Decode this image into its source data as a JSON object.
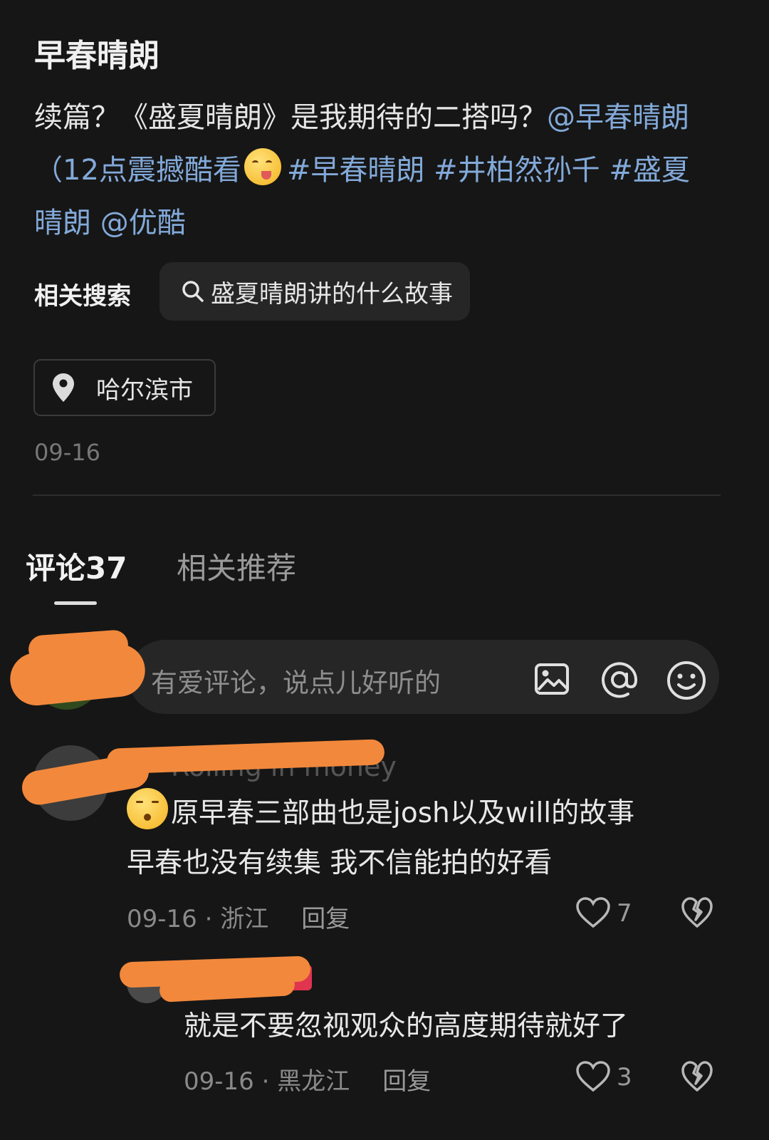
{
  "post": {
    "title": "早春晴朗",
    "desc_plain": "续篇？《盛夏晴朗》是我期待的二搭吗？",
    "mention_1": "@早春晴朗（12点震撼酷看",
    "emoji_1": "yum-face-emoji",
    "tag_1": "#早春晴朗",
    "tag_2": "#井柏然孙千",
    "tag_3": "#盛夏晴朗",
    "mention_2": "@优酷",
    "related_label": "相关搜索",
    "related_query": "盛夏晴朗讲的什么故事",
    "location": "哈尔滨市",
    "date": "09-16"
  },
  "tabs": [
    {
      "label": "评论37",
      "active": true
    },
    {
      "label": "相关推荐",
      "active": false
    }
  ],
  "comment_input": {
    "placeholder": "有爱评论，说点儿好听的",
    "icons": [
      "image-icon",
      "at-icon",
      "emoji-icon"
    ]
  },
  "comments": [
    {
      "username": "Rolling in money",
      "emoji": "raised-eyebrow-face-emoji",
      "text_line1": "原早春三部曲也是josh以及will的故事",
      "text_line2": "早春也没有续集 我不信能拍的好看",
      "date": "09-16",
      "region": "浙江",
      "reply_label": "回复",
      "likes": "7"
    },
    {
      "text": "就是不要忽视观众的高度期待就好了",
      "date": "09-16",
      "region": "黑龙江",
      "reply_label": "回复",
      "likes": "3"
    }
  ],
  "colors": {
    "background": "#161616",
    "link": "#82a9d9",
    "redaction": "#f2883c",
    "badge": "#e0344f"
  }
}
